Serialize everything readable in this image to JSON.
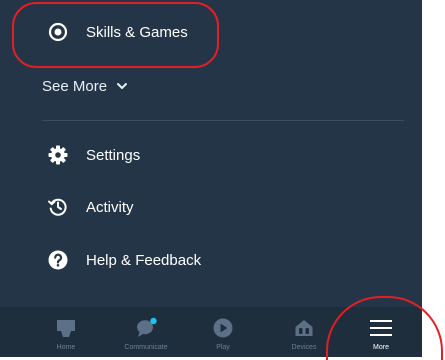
{
  "menu": {
    "skills": {
      "label": "Skills & Games",
      "icon": "skills-bubble-icon"
    },
    "see_more": {
      "label": "See More",
      "icon": "chevron-down-icon"
    },
    "items": [
      {
        "label": "Settings",
        "icon": "gear-icon"
      },
      {
        "label": "Activity",
        "icon": "history-clock-icon"
      },
      {
        "label": "Help & Feedback",
        "icon": "help-question-icon"
      }
    ]
  },
  "bottom_nav": {
    "active": "More",
    "items": [
      {
        "label": "Home",
        "icon": "home-icon"
      },
      {
        "label": "Communicate",
        "icon": "chat-bubble-icon"
      },
      {
        "label": "Play",
        "icon": "play-icon"
      },
      {
        "label": "Devices",
        "icon": "devices-house-icon"
      },
      {
        "label": "More",
        "icon": "hamburger-menu-icon"
      }
    ]
  },
  "colors": {
    "panel_background": "#243547",
    "nav_background": "#1f2e3d",
    "highlight": "#e01f26",
    "inactive_icon": "#5c7187",
    "active_icon": "#ffffff"
  }
}
